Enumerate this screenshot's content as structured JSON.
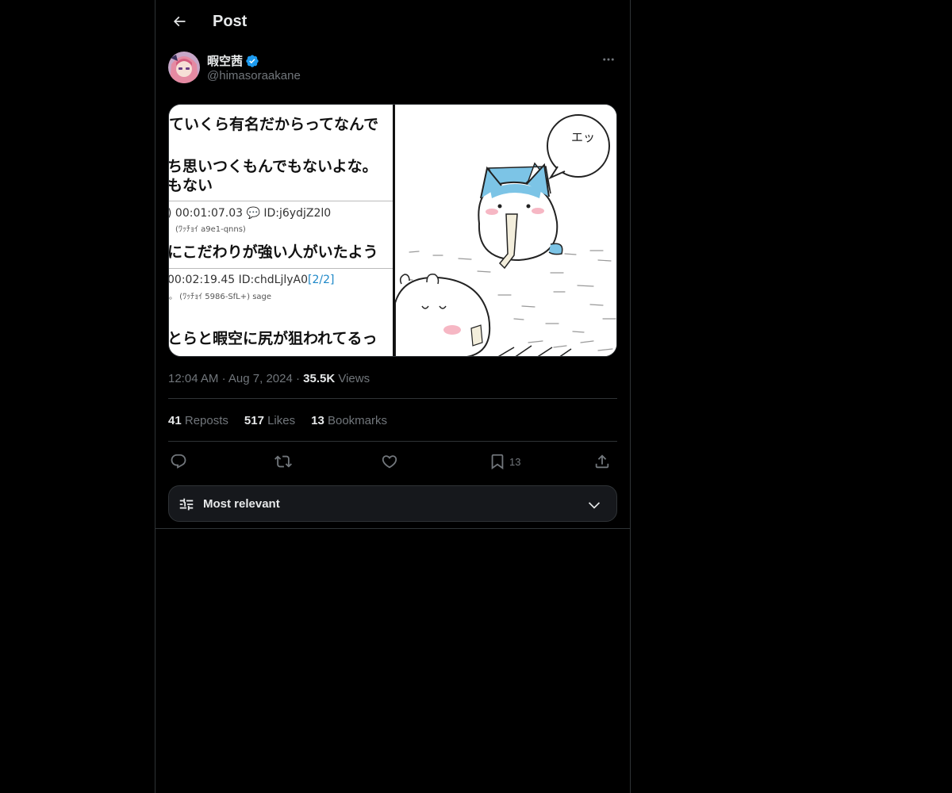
{
  "header": {
    "title": "Post",
    "back_icon": "arrow-left-icon"
  },
  "author": {
    "display_name": "暇空茜",
    "handle": "@himasoraakane",
    "verified_color": "#1d9bf0"
  },
  "media": {
    "left_panel": {
      "lines": [
        "ていくら有名だからってなんで",
        "ち思いつくもんでもないよな。",
        "もない",
        ") 00:01:07.03 💬 ID:j6ydjZ2l0",
        "(ﾜｯﾁｮｲ a9e1-qnns)",
        "にこだわりが強い人がいたよう",
        "00:02:19.45 ID:chdLjlyA0",
        "[2/2]",
        "。 (ﾜｯﾁｮｲ 5986-SfL+) sage",
        "とらと暇空に尻が狙われてるっ"
      ]
    },
    "right_panel": {
      "speech_text": "エッ"
    }
  },
  "timestamp": {
    "time": "12:04 AM",
    "date": "Aug 7, 2024",
    "views_count": "35.5K",
    "views_label": "Views",
    "dot": "·"
  },
  "stats": {
    "reposts_count": "41",
    "reposts_label": "Reposts",
    "likes_count": "517",
    "likes_label": "Likes",
    "bookmarks_count": "13",
    "bookmarks_label": "Bookmarks"
  },
  "actions": {
    "bookmark_count": "13"
  },
  "sort": {
    "label": "Most relevant"
  },
  "colors": {
    "background": "#000000",
    "text": "#e7e9ea",
    "muted": "#71767b",
    "border": "#2f3336",
    "accent": "#1d9bf0"
  }
}
